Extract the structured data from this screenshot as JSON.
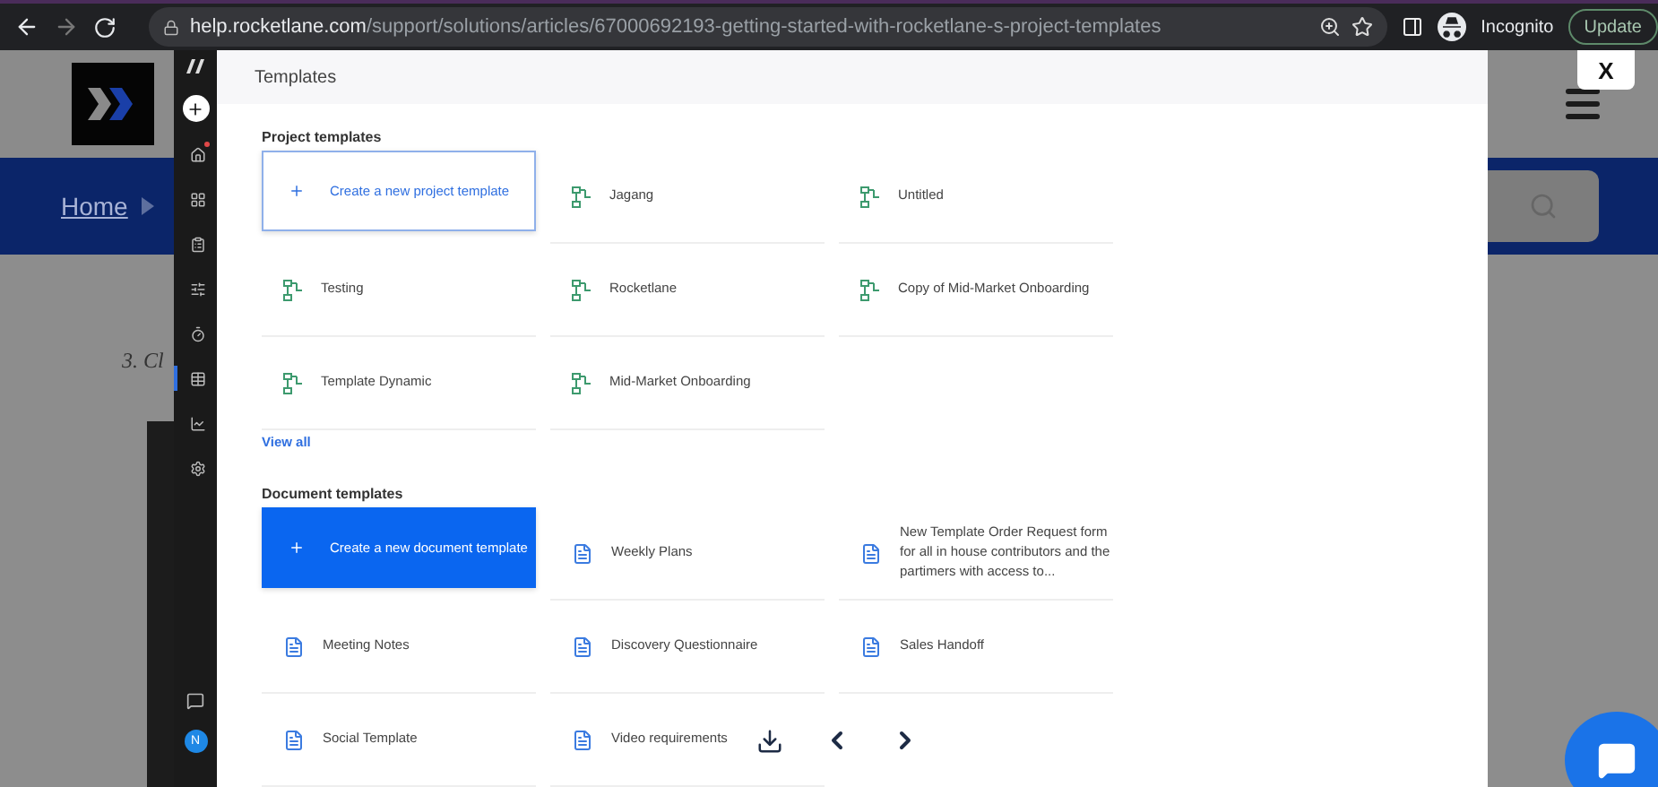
{
  "browser": {
    "url_host": "help.rocketlane.com",
    "url_path": "/support/solutions/articles/67000692193-getting-started-with-rocketlane-s-project-templates",
    "profile": "Incognito",
    "update_button": "Update"
  },
  "background_page": {
    "breadcrumb": "Home",
    "step_text": "3. Cl",
    "close_button": "X"
  },
  "screenshot": {
    "nav_items": [
      {
        "selected": false,
        "notification": true
      },
      {
        "selected": false,
        "notification": false
      },
      {
        "selected": false,
        "notification": false
      },
      {
        "selected": false,
        "notification": false
      },
      {
        "selected": false,
        "notification": false
      },
      {
        "selected": true,
        "notification": false
      },
      {
        "selected": false,
        "notification": false
      },
      {
        "selected": false,
        "notification": false
      }
    ],
    "avatar": "N",
    "title": "Templates",
    "sections": [
      {
        "kind": "project",
        "title": "Project templates",
        "create_label": "Create a new project template",
        "create_highlighted": false,
        "items": [
          "Jagang",
          "Untitled",
          "Testing",
          "Rocketlane",
          "Copy of Mid-Market Onboarding",
          "Template Dynamic",
          "Mid-Market Onboarding"
        ],
        "view_all": "View all"
      },
      {
        "kind": "document",
        "title": "Document templates",
        "create_label": "Create a new document template",
        "create_highlighted": true,
        "items": [
          "Weekly Plans",
          "New Template Order Request form for all in house contributors and the partimers with access to...",
          "Meeting Notes",
          "Discovery Questionnaire",
          "Sales Handoff",
          "Social Template",
          "Video requirements"
        ]
      }
    ]
  }
}
